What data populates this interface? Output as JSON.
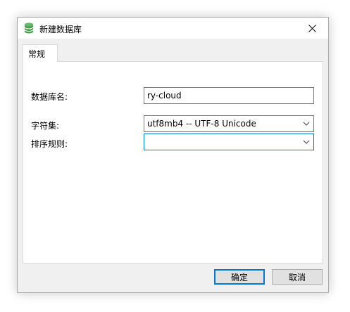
{
  "window": {
    "title": "新建数据库",
    "icon": "database-icon",
    "close_icon": "close-icon"
  },
  "tabs": [
    {
      "label": "常规",
      "active": true
    }
  ],
  "form": {
    "db_name": {
      "label": "数据库名:",
      "value": "ry-cloud"
    },
    "charset": {
      "label": "字符集:",
      "value": "utf8mb4 -- UTF-8 Unicode"
    },
    "collation": {
      "label": "排序规则:",
      "value": ""
    }
  },
  "buttons": {
    "ok": "确定",
    "cancel": "取消"
  },
  "colors": {
    "accent": "#0078d7",
    "db_icon": "#4caf50"
  }
}
